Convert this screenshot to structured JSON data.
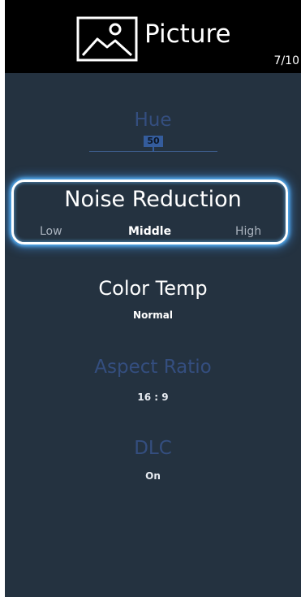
{
  "header": {
    "title": "Picture",
    "icon": "picture-icon",
    "page_indicator": "7/10"
  },
  "menu": {
    "hue": {
      "label": "Hue",
      "value": "50",
      "level": 50
    },
    "noise_reduction": {
      "label": "Noise Reduction",
      "options": [
        "Low",
        "Middle",
        "High"
      ],
      "selected": "Middle"
    },
    "color_temp": {
      "label": "Color Temp",
      "value": "Normal"
    },
    "aspect_ratio": {
      "label": "Aspect Ratio",
      "value": "16 : 9"
    },
    "dlc": {
      "label": "DLC",
      "value": "On"
    }
  },
  "colors": {
    "background": "#243240",
    "header": "#000000",
    "focus_glow": "#58b8ff",
    "dim_label": "#344e7f"
  }
}
